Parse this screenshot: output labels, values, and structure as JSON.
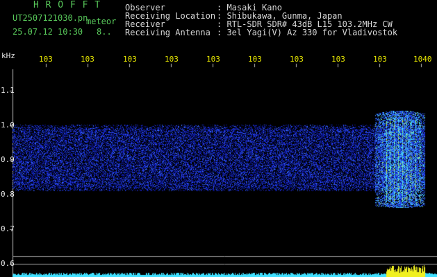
{
  "header": {
    "app_logo": "H R O F F T",
    "filename": "UT2507121030.pn",
    "type_label": "meteor",
    "datetime": "25.07.12 10:30",
    "count_label": "8..",
    "fields": [
      {
        "label": "Observer",
        "value": ": Masaki Kano"
      },
      {
        "label": "Receiving Location",
        "value": ": Shibukawa, Gunma, Japan"
      },
      {
        "label": "Receiver",
        "value": ": RTL-SDR SDR# 43dB L15 103.2MHz CW"
      },
      {
        "label": "Receiving Antenna",
        "value": ": 3el Yagi(V) Az 330 for Vladivostok"
      }
    ]
  },
  "axis": {
    "unit_label": "kHz",
    "time_ticks": [
      "103",
      "103",
      "103",
      "103",
      "103",
      "103",
      "103",
      "103",
      "103",
      "1040"
    ],
    "freq_ticks": [
      "1.1",
      "1.0",
      "0.9",
      "0.8",
      "0.7",
      "0.6"
    ]
  },
  "colors": {
    "background": "#000000",
    "header_green": "#58c85a",
    "header_white": "#d8d8d8",
    "tick_yellow": "#e6e600",
    "noise_blue": "#2030d8",
    "signal_cyan": "#40e0ff",
    "signal_yellow": "#f0f020"
  }
}
